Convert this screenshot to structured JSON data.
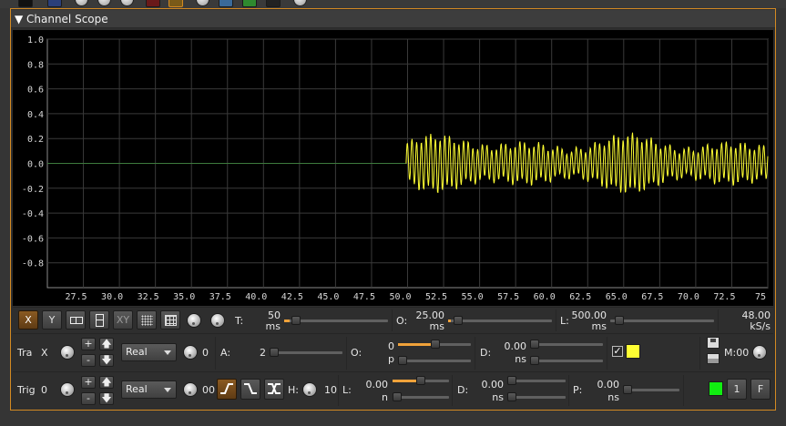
{
  "panel": {
    "title": "Channel Scope",
    "collapse_glyph": "▼"
  },
  "colors": {
    "accent": "#d38a22",
    "trace_color": "#ffff33",
    "trigger_color": "#11ee11",
    "scope_bg": "#000000",
    "grid": "#3a3a3a"
  },
  "toolbar": {
    "icons": [
      "display-icon",
      "channel-icon",
      "knob-icon",
      "knob-icon",
      "knob-icon",
      "spectrum-icon",
      "waveform-icon",
      "knob-icon",
      "palette-icon",
      "color-icon",
      "grid-icon",
      "knob-icon"
    ]
  },
  "chart_data": {
    "type": "line",
    "ylim": [
      -1.0,
      1.0
    ],
    "y_ticks": [
      "1.0",
      "0.8",
      "0.6",
      "0.4",
      "0.2",
      "0.0",
      "-0.2",
      "-0.4",
      "-0.6",
      "-0.8"
    ],
    "xlim": [
      25.0,
      75.0
    ],
    "x_ticks": [
      "27.5",
      "30.0",
      "32.5",
      "35.0",
      "37.5",
      "40.0",
      "42.5",
      "45.0",
      "47.5",
      "50.0",
      "52.5",
      "55.0",
      "57.5",
      "60.0",
      "62.5",
      "65.0",
      "67.5",
      "70.0",
      "72.5",
      "75"
    ],
    "grid": true,
    "series": [
      {
        "segment": "flat",
        "x_start": 25.0,
        "x_end": 49.9,
        "value": 0.0,
        "color": "#3d7a3d"
      },
      {
        "segment": "oscillation",
        "x_start": 49.9,
        "x_end": 75.0,
        "amplitude_min": 0.08,
        "amplitude_max": 0.22,
        "offset": 0.0,
        "color": "#ffff33"
      }
    ]
  },
  "controls": {
    "row1": {
      "buttons": [
        {
          "label": "X",
          "active": true
        },
        {
          "label": "Y",
          "active": false
        },
        {
          "label": "",
          "icon": "side-by-side-icon"
        },
        {
          "label": "",
          "icon": "stacked-icon"
        },
        {
          "label": "XY",
          "active": false
        },
        {
          "label": "",
          "icon": "grid-dots-icon"
        },
        {
          "label": "",
          "icon": "grid-lines-icon"
        }
      ],
      "time": {
        "label": "T:",
        "value": "50",
        "unit": "ms",
        "level": 0.04
      },
      "offset": {
        "label": "O:",
        "value": "25.00",
        "unit": "ms",
        "level": 0.02
      },
      "length": {
        "label": "L:",
        "value": "500.00",
        "unit": "ms",
        "level": 0.0
      },
      "rate": {
        "value": "48.00",
        "unit": "kS/s"
      }
    },
    "row2": {
      "label": "Tra",
      "trace_index": "X",
      "projection": "Real",
      "knob_value": "0",
      "amp": {
        "label": "A:",
        "value": "2",
        "level": 0.0
      },
      "offset": {
        "label": "O:",
        "value": "0",
        "unit": "p",
        "level_coarse": 0.55,
        "level_fine": 0.0
      },
      "delay": {
        "label": "D:",
        "value": "0.00",
        "unit": "ns",
        "level": 0.0
      },
      "check": "✓",
      "mem": "M:00"
    },
    "row3": {
      "label": "Trig",
      "trig_index": "0",
      "projection": "Real",
      "knob_value": "00",
      "hyst": {
        "label": "H:",
        "value": "10"
      },
      "level": {
        "label": "L:",
        "value": "0.00",
        "unit": "n",
        "level_coarse": 0.45,
        "level_fine": 0.0
      },
      "delay": {
        "label": "D:",
        "value": "0.00",
        "unit": "ns",
        "level": 0.0
      },
      "pre": {
        "label": "P:",
        "value": "0.00",
        "unit": "ns",
        "level": 0.0
      },
      "one_shot": "1",
      "freerun": "F"
    }
  }
}
